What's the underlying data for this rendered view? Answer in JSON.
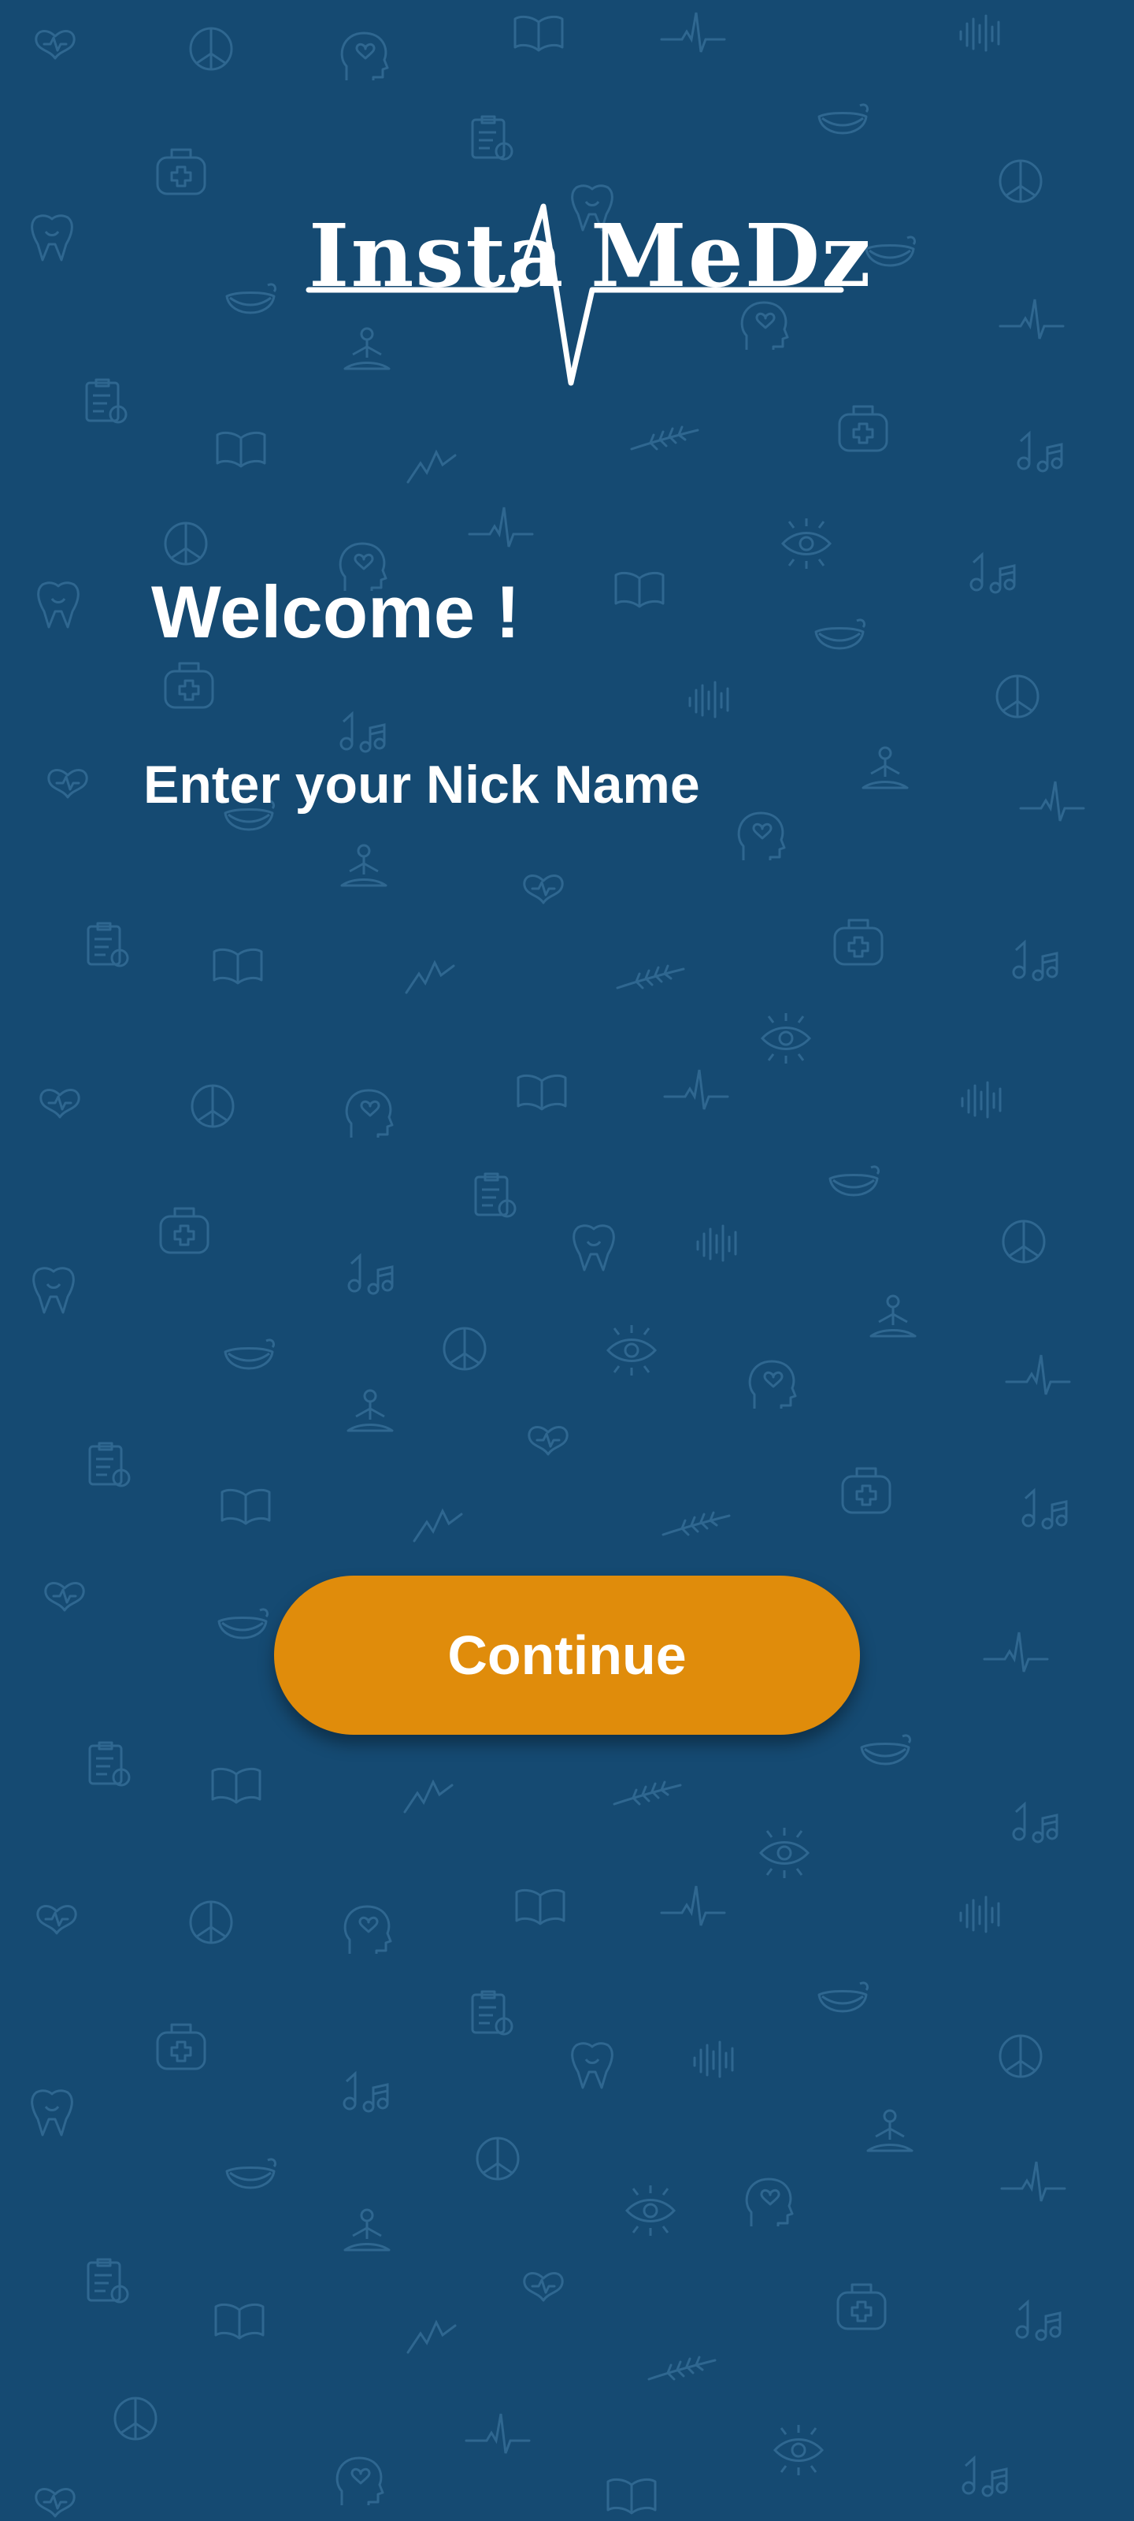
{
  "app": {
    "logo_left": "Insta",
    "logo_right": "MeDz"
  },
  "welcome": {
    "title": "Welcome !",
    "nick_label": "Enter your Nick Name",
    "nick_value": "",
    "nick_placeholder": ""
  },
  "actions": {
    "continue_label": "Continue"
  },
  "colors": {
    "background": "#154a72",
    "pattern_stroke": "#2f6790",
    "button": "#e08c0b",
    "text": "#ffffff"
  },
  "background_icons": [
    "heart-icon",
    "peace-sign-icon",
    "head-heart-icon",
    "book-icon",
    "heartbeat-line-icon",
    "first-aid-kit-icon",
    "tooth-icon",
    "smile-mask-icon",
    "meditation-icon",
    "clipboard-icon",
    "eye-icon",
    "music-notes-icon",
    "wheat-icon",
    "sound-wave-icon"
  ]
}
